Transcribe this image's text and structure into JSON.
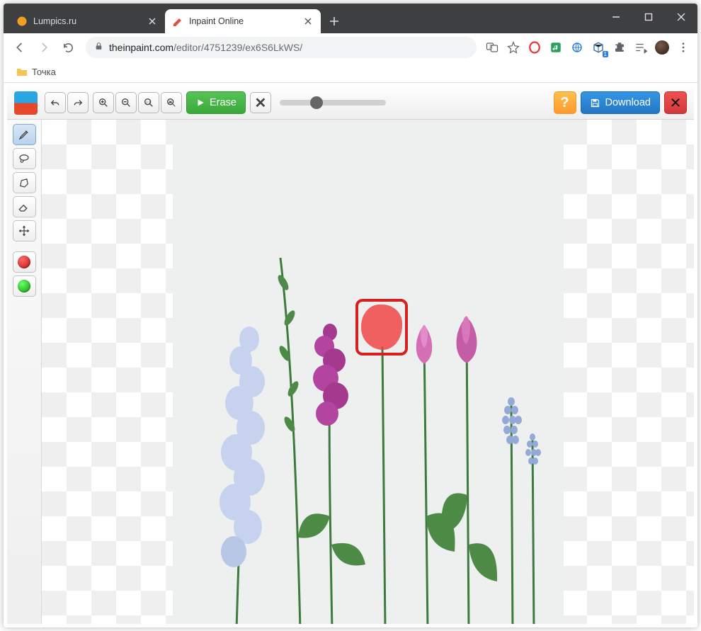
{
  "window": {
    "tabs": [
      {
        "title": "Lumpics.ru",
        "active": false,
        "fav": "#f0a020"
      },
      {
        "title": "Inpaint Online",
        "active": true,
        "fav": "#e74c3c"
      }
    ]
  },
  "address": {
    "domain": "theinpaint.com",
    "path": "/editor/4751239/ex6S6LkWS/"
  },
  "bookmarks": [
    {
      "label": "Точка"
    }
  ],
  "toolbar": {
    "erase_label": "Erase",
    "help_label": "?",
    "download_label": "Download"
  },
  "side_tools": [
    {
      "name": "marker-tool",
      "active": true
    },
    {
      "name": "lasso-tool",
      "active": false
    },
    {
      "name": "polygon-tool",
      "active": false
    },
    {
      "name": "eraser-tool",
      "active": false
    },
    {
      "name": "move-tool",
      "active": false
    }
  ],
  "mask_colors": {
    "red": "#d81f1f",
    "green": "#1faa1f"
  },
  "colors": {
    "accent_green": "#3aa83a",
    "accent_blue": "#2276c4",
    "accent_orange": "#ff9a2e"
  }
}
